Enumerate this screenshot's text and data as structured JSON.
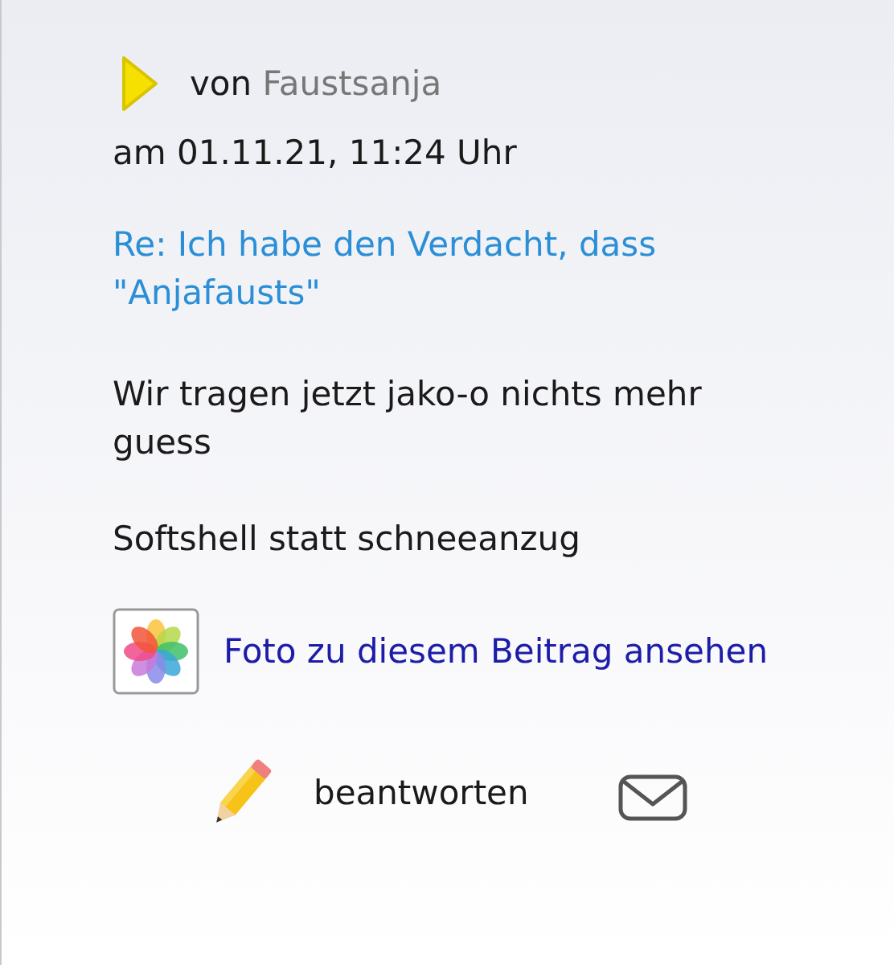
{
  "post": {
    "author_prefix": "von",
    "author": "Faustsanja",
    "date": "am 01.11.21, 11:24 Uhr",
    "title": "Re: Ich habe den Verdacht, dass \"Anjafausts\"",
    "paragraphs": [
      "Wir tragen jetzt jako-o nichts mehr guess",
      "Softshell statt schneeanzug"
    ],
    "photo_link": "Foto zu diesem Beitrag ansehen"
  },
  "actions": {
    "reply": "beantworten"
  }
}
